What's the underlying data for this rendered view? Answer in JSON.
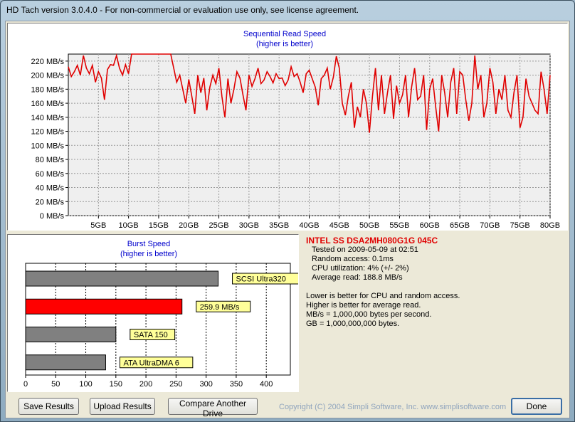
{
  "window": {
    "title": "HD Tach version 3.0.4.0  - For non-commercial or evaluation use only, see license agreement."
  },
  "seq_chart": {
    "title": "Sequential Read Speed",
    "subtitle": "(higher is better)",
    "color": "#e00000"
  },
  "burst_chart": {
    "title": "Burst Speed",
    "subtitle": "(higher is better)"
  },
  "info": {
    "drive_name": "INTEL SS DSA2MH080G1G 045C",
    "tested_on": "Tested on 2009-05-09 at 02:51",
    "random_access": "Random access: 0.1ms",
    "cpu_utilization": "CPU utilization: 4% (+/- 2%)",
    "average_read": "Average read: 188.8 MB/s",
    "note1": "Lower is better for CPU and random access.",
    "note2": "Higher is better for average read.",
    "note3": "MB/s = 1,000,000 bytes per second.",
    "note4": "GB = 1,000,000,000 bytes."
  },
  "buttons": {
    "save": "Save Results",
    "upload": "Upload Results",
    "compare": "Compare Another Drive",
    "done": "Done"
  },
  "copyright": "Copyright (C) 2004 Simpli Software, Inc. www.simplisoftware.com",
  "chart_data": [
    {
      "type": "line",
      "title": "Sequential Read Speed",
      "subtitle": "(higher is better)",
      "xlabel": "",
      "ylabel": "",
      "x_ticks": [
        "5GB",
        "10GB",
        "15GB",
        "20GB",
        "25GB",
        "30GB",
        "35GB",
        "40GB",
        "45GB",
        "50GB",
        "55GB",
        "60GB",
        "65GB",
        "70GB",
        "75GB",
        "80GB"
      ],
      "y_ticks": [
        "0 MB/s",
        "20 MB/s",
        "40 MB/s",
        "60 MB/s",
        "80 MB/s",
        "100 MB/s",
        "120 MB/s",
        "140 MB/s",
        "160 MB/s",
        "180 MB/s",
        "200 MB/s",
        "220 MB/s"
      ],
      "xlim": [
        0,
        80
      ],
      "ylim": [
        0,
        230
      ],
      "grid": true,
      "series": [
        {
          "color": "#e00000",
          "x": [
            0,
            0.5,
            1,
            1.5,
            2,
            2.5,
            3,
            3.5,
            4,
            4.5,
            5,
            5.5,
            6,
            6.5,
            7,
            7.5,
            8,
            8.5,
            9,
            9.5,
            10,
            10.5,
            11,
            11.5,
            12,
            12.5,
            13,
            13.5,
            14,
            14.5,
            15,
            15.5,
            16,
            16.5,
            17,
            17.5,
            18,
            18.5,
            19,
            19.5,
            20,
            20.5,
            21,
            21.5,
            22,
            22.5,
            23,
            23.5,
            24,
            24.5,
            25,
            25.5,
            26,
            26.5,
            27,
            27.5,
            28,
            28.5,
            29,
            29.5,
            30,
            30.5,
            31,
            31.5,
            32,
            32.5,
            33,
            33.5,
            34,
            34.5,
            35,
            35.5,
            36,
            36.5,
            37,
            37.5,
            38,
            38.5,
            39,
            39.5,
            40,
            40.5,
            41,
            41.5,
            42,
            42.5,
            43,
            43.5,
            44,
            44.5,
            45,
            45.5,
            46,
            46.5,
            47,
            47.5,
            48,
            48.5,
            49,
            49.5,
            50,
            50.5,
            51,
            51.5,
            52,
            52.5,
            53,
            53.5,
            54,
            54.5,
            55,
            55.5,
            56,
            56.5,
            57,
            57.5,
            58,
            58.5,
            59,
            59.5,
            60,
            60.5,
            61,
            61.5,
            62,
            62.5,
            63,
            63.5,
            64,
            64.5,
            65,
            65.5,
            66,
            66.5,
            67,
            67.5,
            68,
            68.5,
            69,
            69.5,
            70,
            70.5,
            71,
            71.5,
            72,
            72.5,
            73,
            73.5,
            74,
            74.5,
            75,
            75.5,
            76,
            76.5,
            77,
            77.5,
            78,
            78.5,
            79,
            79.5,
            80
          ],
          "y": [
            212,
            198,
            205,
            214,
            200,
            228,
            210,
            202,
            214,
            190,
            205,
            196,
            165,
            208,
            215,
            214,
            228,
            210,
            200,
            215,
            202,
            230,
            230,
            230,
            230,
            230,
            230,
            230,
            230,
            230,
            230,
            230,
            230,
            230,
            230,
            210,
            190,
            200,
            180,
            160,
            194,
            170,
            145,
            200,
            175,
            196,
            150,
            183,
            200,
            188,
            210,
            170,
            140,
            195,
            160,
            180,
            205,
            196,
            172,
            150,
            200,
            184,
            195,
            210,
            188,
            193,
            205,
            198,
            189,
            202,
            195,
            196,
            185,
            193,
            212,
            198,
            202,
            190,
            175,
            202,
            207,
            195,
            183,
            157,
            195,
            200,
            210,
            180,
            197,
            227,
            210,
            160,
            143,
            170,
            190,
            125,
            155,
            140,
            180,
            160,
            118,
            170,
            210,
            150,
            200,
            145,
            175,
            200,
            138,
            185,
            160,
            172,
            200,
            140,
            183,
            210,
            165,
            170,
            200,
            122,
            180,
            195,
            155,
            120,
            200,
            175,
            140,
            190,
            210,
            145,
            205,
            200,
            165,
            135,
            160,
            228,
            180,
            200,
            140,
            160,
            210,
            190,
            145,
            180,
            165,
            200,
            150,
            140,
            175,
            200,
            125,
            140,
            195,
            170,
            160,
            150,
            145,
            205,
            180,
            145,
            200
          ]
        }
      ]
    },
    {
      "type": "bar",
      "orientation": "horizontal",
      "title": "Burst Speed",
      "subtitle": "(higher is better)",
      "categories": [
        "SCSI Ultra320",
        "259.9 MB/s",
        "SATA 150",
        "ATA UltraDMA 6"
      ],
      "values": [
        320,
        259.9,
        150,
        133
      ],
      "colors": [
        "#808080",
        "#ff0000",
        "#808080",
        "#808080"
      ],
      "x_ticks": [
        "0",
        "50",
        "100",
        "150",
        "200",
        "250",
        "300",
        "350",
        "400"
      ],
      "xlim": [
        0,
        440
      ]
    }
  ]
}
